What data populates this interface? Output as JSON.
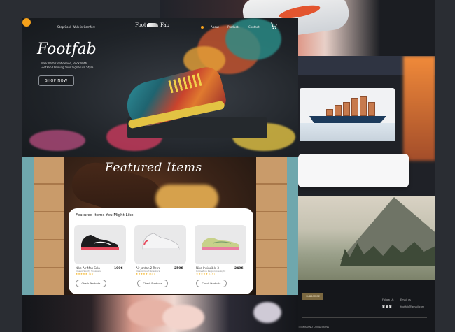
{
  "hero": {
    "tagline": "Step Cool, Walk in Comfort",
    "brand_left": "Foot",
    "brand_right": "Fab",
    "nav": [
      "About",
      "Products",
      "Contact"
    ],
    "title": "Footfab",
    "subtitle_line1": "Walk With Confidence, Rock With",
    "subtitle_line2": "FootFab Defining Your Signature Style.",
    "cta": "SHOP NOW"
  },
  "featured": {
    "banner_title": "Featured Items",
    "card_title": "Featured Items You Might Like",
    "products": [
      {
        "name": "Nike Air Max Sola",
        "desc": "Classic Sporty Sneakers",
        "price": "199€",
        "stars": "★★★★★ (26)",
        "button": "Check Products"
      },
      {
        "name": "Air Jordan 2 Retro",
        "desc": "Classic Court Sneakers",
        "price": "259€",
        "stars": "★★★★★ (34)",
        "button": "Check Products"
      },
      {
        "name": "Nike Invincible 3",
        "desc": "Innovative Responsive Light",
        "price": "249€",
        "stars": "★★★★★ (19)",
        "button": "Check Products"
      }
    ]
  },
  "footer": {
    "subscribe": "SUBSCRIBE",
    "follow": "Follow Us",
    "email_label": "Email us",
    "socials": "◙◙◙",
    "email": "footfab@gmail.com",
    "terms": "TERMS AND CONDITIONS"
  },
  "colors": {
    "accent": "#f6a21b",
    "card_bg": "#ffffff",
    "hero_bg": "#1f2328"
  }
}
